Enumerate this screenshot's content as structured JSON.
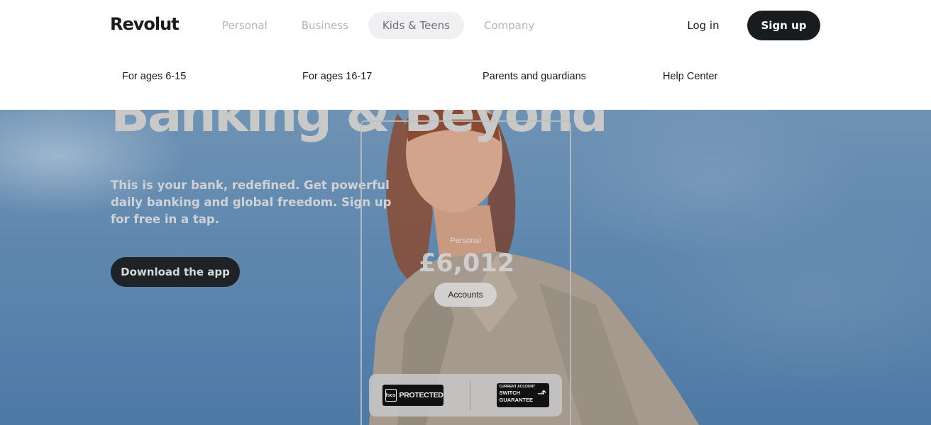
{
  "header": {
    "logo": "Revolut",
    "nav": [
      "Personal",
      "Business",
      "Kids & Teens",
      "Company"
    ],
    "active_nav": "Kids & Teens",
    "login": "Log in",
    "signup": "Sign up",
    "subnav": [
      "For ages 6-15",
      "For ages 16-17",
      "Parents and guardians",
      "Help Center"
    ]
  },
  "hero": {
    "title": "Banking & Beyond",
    "text": "This is your bank, redefined. Get powerful daily banking and global freedom. Sign up for free in a tap.",
    "cta": "Download the app"
  },
  "phone": {
    "label": "Personal",
    "balance": "£6,012",
    "button": "Accounts"
  },
  "badges": {
    "fscs_mark": "fscs",
    "fscs_text": "PROTECTED",
    "switch_small": "CURRENT ACCOUNT",
    "switch_line1": "SWITCH",
    "switch_line2": "GUARANTEE"
  },
  "colors": {
    "dark": "#191c1f",
    "sky": "#5a84ad",
    "nav_active_bg": "#f0f0f2"
  }
}
